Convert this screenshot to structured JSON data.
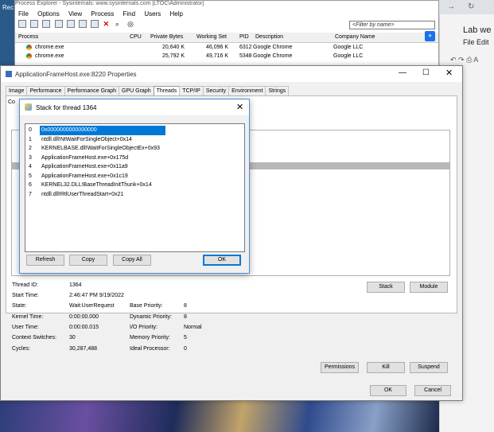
{
  "right_panel": {
    "doc_title": "Lab we",
    "menu": "File Edit"
  },
  "process_explorer": {
    "title_fragment": "Process Explorer - Sysinternals: www.sysinternals.com [LTOC\\Administrator]",
    "corner_label": "Rec",
    "menu": [
      "File",
      "Options",
      "View",
      "Process",
      "Find",
      "Users",
      "Help"
    ],
    "filter_placeholder": "<Filter by name>",
    "columns": [
      "Process",
      "CPU",
      "Private Bytes",
      "Working Set",
      "PID",
      "Description",
      "Company Name"
    ],
    "rows": [
      {
        "name": "chrome.exe",
        "cpu": "",
        "private": "20,640 K",
        "working": "46,096 K",
        "pid": "6312",
        "desc": "Google Chrome",
        "company": "Google LLC"
      },
      {
        "name": "chrome.exe",
        "cpu": "",
        "private": "25,792 K",
        "working": "49,716 K",
        "pid": "5348",
        "desc": "Google Chrome",
        "company": "Google LLC"
      }
    ]
  },
  "properties": {
    "title": "ApplicationFrameHost.exe:8220 Properties",
    "tabs": [
      "Image",
      "Performance",
      "Performance Graph",
      "GPU Graph",
      "Threads",
      "TCP/IP",
      "Security",
      "Environment",
      "Strings"
    ],
    "active_tab": "Threads",
    "count_label": "Co",
    "fields_left": [
      {
        "label": "Thread ID:",
        "value": "1364"
      },
      {
        "label": "Start Time:",
        "value": "2:46:47 PM  9/19/2022"
      },
      {
        "label": "State:",
        "value": "Wait:UserRequest"
      },
      {
        "label": "Kernel Time:",
        "value": "0:00:00.000"
      },
      {
        "label": "User Time:",
        "value": "0:00:00.015"
      },
      {
        "label": "Context Switches:",
        "value": "30"
      },
      {
        "label": "Cycles:",
        "value": "30,287,488"
      }
    ],
    "fields_right": [
      {
        "label": "Base Priority:",
        "value": "8"
      },
      {
        "label": "Dynamic Priority:",
        "value": "8"
      },
      {
        "label": "I/O Priority:",
        "value": "Normal"
      },
      {
        "label": "Memory Priority:",
        "value": "5"
      },
      {
        "label": "Ideal Processor:",
        "value": "0"
      }
    ],
    "buttons": {
      "stack": "Stack",
      "module": "Module",
      "permissions": "Permissions",
      "kill": "Kill",
      "suspend": "Suspend",
      "ok": "OK",
      "cancel": "Cancel"
    }
  },
  "stack_dialog": {
    "title": "Stack for thread 1364",
    "frames": [
      {
        "index": "0",
        "frame": "0x0000000000000000"
      },
      {
        "index": "1",
        "frame": "ntdll.dll!NtWaitForSingleObject+0x14"
      },
      {
        "index": "2",
        "frame": "KERNELBASE.dll!WaitForSingleObjectEx+0x93"
      },
      {
        "index": "3",
        "frame": "ApplicationFrameHost.exe+0x175d"
      },
      {
        "index": "4",
        "frame": "ApplicationFrameHost.exe+0x11a9"
      },
      {
        "index": "5",
        "frame": "ApplicationFrameHost.exe+0x1c19"
      },
      {
        "index": "6",
        "frame": "KERNEL32.DLL!BaseThreadInitThunk+0x14"
      },
      {
        "index": "7",
        "frame": "ntdll.dll!RtlUserThreadStart+0x21"
      }
    ],
    "buttons": {
      "refresh": "Refresh",
      "copy": "Copy",
      "copy_all": "Copy All",
      "ok": "OK"
    }
  }
}
